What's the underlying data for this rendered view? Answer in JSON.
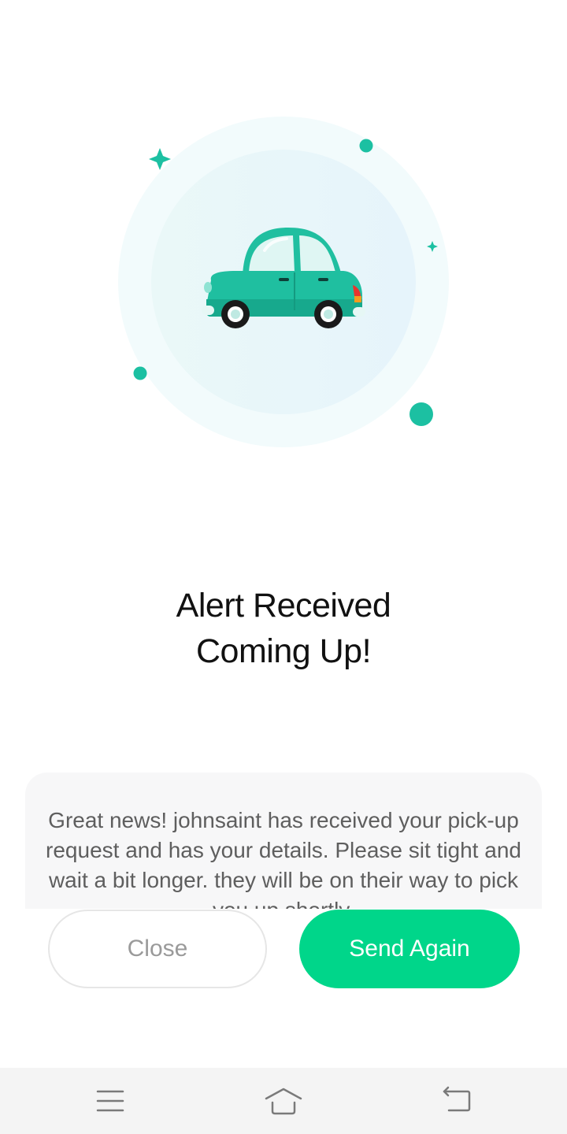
{
  "alert": {
    "title_line1": "Alert Received",
    "title_line2": "Coming Up!",
    "message": "Great news! johnsaint has received your pick-up request and has your details. Please sit tight and wait a bit longer. they will be on their way to pick you up shortly."
  },
  "actions": {
    "close_label": "Close",
    "send_again_label": "Send Again"
  },
  "nav_bar": {
    "icons": [
      "menu-icon",
      "home-icon",
      "back-icon"
    ]
  },
  "colors": {
    "accent": "#00d68a",
    "car_body": "#1fbfa0",
    "sparkle": "#1cc0a2",
    "title_text": "#111111",
    "message_text": "#5e5e5e"
  }
}
